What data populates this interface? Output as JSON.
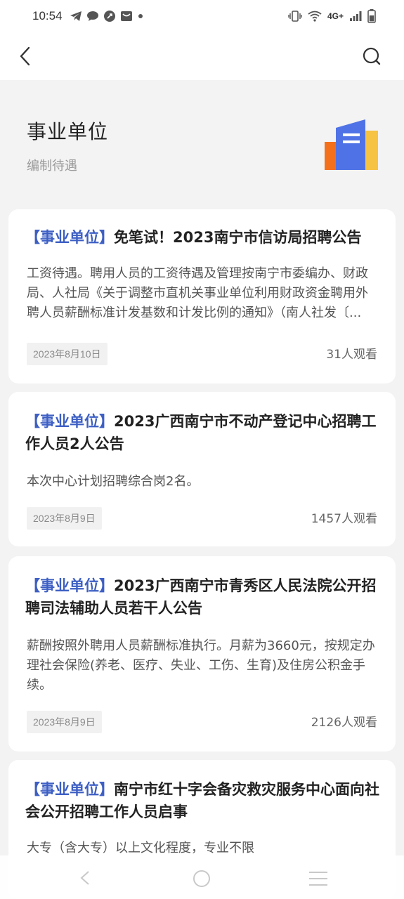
{
  "status_bar": {
    "time": "10:54",
    "left_icons": [
      "telegram-icon",
      "message-icon",
      "app-icon",
      "mail-icon",
      "dot-icon"
    ],
    "right_icons": [
      "vibrate-icon",
      "wifi-icon",
      "signal-icon",
      "battery-icon"
    ],
    "network": "4G+"
  },
  "nav": {
    "back_icon": "back-arrow-icon",
    "search_icon": "search-icon"
  },
  "header": {
    "title": "事业单位",
    "subtitle": "编制待遇",
    "logo_colors": [
      "#f5701a",
      "#f6c343",
      "#4f73e6"
    ]
  },
  "colors": {
    "tag": "#3d5fc4",
    "background": "#f3f3f3",
    "card": "#ffffff"
  },
  "articles": [
    {
      "tag": "【事业单位】",
      "title": "免笔试！2023南宁市信访局招聘公告",
      "desc": "工资待遇。聘用人员的工资待遇及管理按南宁市委编办、财政局、人社局《关于调整市直机关事业单位利用财政资金聘用外聘人员薪酬标准计发基数和计发比例的通知》（南人社发〔...",
      "date": "2023年8月10日",
      "views": "31人观看"
    },
    {
      "tag": "【事业单位】",
      "title": "2023广西南宁市不动产登记中心招聘工作人员2人公告",
      "desc": "本次中心计划招聘综合岗2名。",
      "date": "2023年8月9日",
      "views": "1457人观看"
    },
    {
      "tag": "【事业单位】",
      "title": "2023广西南宁市青秀区人民法院公开招聘司法辅助人员若干人公告",
      "desc": "薪酬按照外聘用人员薪酬标准执行。月薪为3660元，按规定办理社会保险(养老、医疗、失业、工伤、生育)及住房公积金手续。",
      "date": "2023年8月9日",
      "views": "2126人观看"
    },
    {
      "tag": "【事业单位】",
      "title": "南宁市红十字会备灾救灾服务中心面向社会公开招聘工作人员启事",
      "desc": "大专（含大专）以上文化程度，专业不限"
    }
  ],
  "system_nav": {
    "back": "nav-back-icon",
    "home": "nav-home-icon",
    "menu": "nav-menu-icon"
  }
}
